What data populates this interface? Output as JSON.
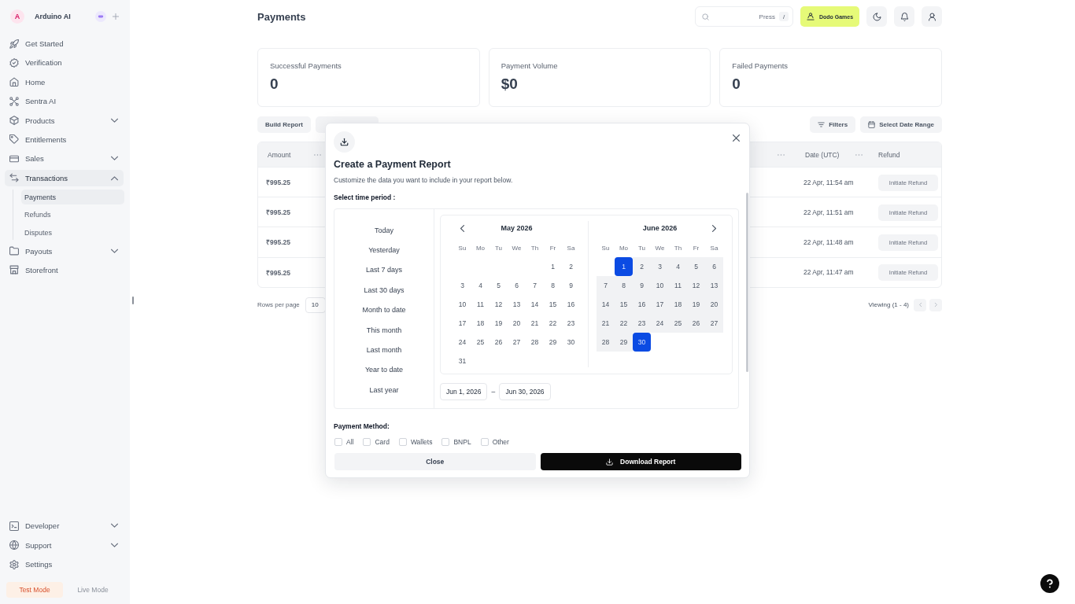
{
  "sidebar": {
    "workspace": {
      "initial": "A",
      "name": "Arduino AI"
    },
    "nav": [
      {
        "label": "Get Started",
        "kind": "link",
        "selected": false
      },
      {
        "label": "Verification",
        "kind": "link",
        "selected": false
      },
      {
        "label": "Home",
        "kind": "link",
        "selected": false
      },
      {
        "label": "Sentra AI",
        "kind": "link",
        "selected": false
      },
      {
        "label": "Products",
        "kind": "group",
        "selected": false,
        "expanded": false
      },
      {
        "label": "Entitlements",
        "kind": "link",
        "selected": false
      },
      {
        "label": "Sales",
        "kind": "group",
        "selected": false,
        "expanded": false
      },
      {
        "label": "Transactions",
        "kind": "group",
        "selected": true,
        "expanded": true,
        "children": [
          {
            "label": "Payments",
            "selected": true
          },
          {
            "label": "Refunds",
            "selected": false
          },
          {
            "label": "Disputes",
            "selected": false
          }
        ]
      },
      {
        "label": "Payouts",
        "kind": "group",
        "selected": false,
        "expanded": false
      },
      {
        "label": "Storefront",
        "kind": "link",
        "selected": false
      }
    ],
    "bottom_nav": [
      {
        "label": "Developer",
        "kind": "group",
        "expanded": false
      },
      {
        "label": "Support",
        "kind": "group",
        "expanded": false
      },
      {
        "label": "Settings",
        "kind": "link"
      }
    ],
    "modes": [
      {
        "label": "Test Mode",
        "selected": true
      },
      {
        "label": "Live Mode",
        "selected": false
      }
    ]
  },
  "header": {
    "title": "Payments",
    "search": {
      "hint": "Press",
      "shortcut": "/"
    },
    "business_button": "Dodo Games"
  },
  "stats": [
    {
      "label": "Successful Payments",
      "value": "0"
    },
    {
      "label": "Payment Volume",
      "value": "$0"
    },
    {
      "label": "Failed Payments",
      "value": "0"
    }
  ],
  "toolbar": {
    "left": [
      "Build Report"
    ],
    "right": [
      "Filters",
      "Select Date Range"
    ]
  },
  "table": {
    "columns": [
      "Amount",
      "Date (UTC)",
      "Refund"
    ],
    "rows": [
      {
        "amount": "₹995.25",
        "date": "22 Apr, 11:54 am",
        "action": "Initiate Refund"
      },
      {
        "amount": "₹995.25",
        "date": "22 Apr, 11:51 am",
        "action": "Initiate Refund"
      },
      {
        "amount": "₹995.25",
        "date": "22 Apr, 11:48 am",
        "action": "Initiate Refund"
      },
      {
        "amount": "₹995.25",
        "date": "22 Apr, 11:47 am",
        "action": "Initiate Refund"
      }
    ]
  },
  "pagination": {
    "rows_label": "Rows per page",
    "rows_value": "10",
    "viewing": "Viewing (1 - 4)"
  },
  "report_dialog": {
    "title": "Create a Payment Report",
    "subtitle": "Customize the data you want to include in your report below.",
    "period_label": "Select time period :",
    "presets": [
      "Today",
      "Yesterday",
      "Last 7 days",
      "Last 30 days",
      "Month to date",
      "This month",
      "Last month",
      "Year to date",
      "Last year"
    ],
    "calendars": [
      {
        "title": "May 2026",
        "weekdays": [
          "Su",
          "Mo",
          "Tu",
          "We",
          "Th",
          "Fr",
          "Sa"
        ],
        "weeks": [
          [
            {
              "day": "1",
              "in_range": false,
              "selected": false
            },
            {
              "day": "2",
              "in_range": false,
              "selected": false
            }
          ],
          [
            {
              "day": "3",
              "in_range": false,
              "selected": false
            },
            {
              "day": "4",
              "in_range": false,
              "selected": false
            },
            {
              "day": "5",
              "in_range": false,
              "selected": false
            },
            {
              "day": "6",
              "in_range": false,
              "selected": false
            },
            {
              "day": "7",
              "in_range": false,
              "selected": false
            },
            {
              "day": "8",
              "in_range": false,
              "selected": false
            },
            {
              "day": "9",
              "in_range": false,
              "selected": false
            }
          ],
          [
            {
              "day": "10",
              "in_range": false,
              "selected": false
            },
            {
              "day": "11",
              "in_range": false,
              "selected": false
            },
            {
              "day": "12",
              "in_range": false,
              "selected": false
            },
            {
              "day": "13",
              "in_range": false,
              "selected": false
            },
            {
              "day": "14",
              "in_range": false,
              "selected": false
            },
            {
              "day": "15",
              "in_range": false,
              "selected": false
            },
            {
              "day": "16",
              "in_range": false,
              "selected": false
            }
          ],
          [
            {
              "day": "17",
              "in_range": false,
              "selected": false
            },
            {
              "day": "18",
              "in_range": false,
              "selected": false
            },
            {
              "day": "19",
              "in_range": false,
              "selected": false
            },
            {
              "day": "20",
              "in_range": false,
              "selected": false
            },
            {
              "day": "21",
              "in_range": false,
              "selected": false
            },
            {
              "day": "22",
              "in_range": false,
              "selected": false
            },
            {
              "day": "23",
              "in_range": false,
              "selected": false
            }
          ],
          [
            {
              "day": "24",
              "in_range": false,
              "selected": false
            },
            {
              "day": "25",
              "in_range": false,
              "selected": false
            },
            {
              "day": "26",
              "in_range": false,
              "selected": false
            },
            {
              "day": "27",
              "in_range": false,
              "selected": false
            },
            {
              "day": "28",
              "in_range": false,
              "selected": false
            },
            {
              "day": "29",
              "in_range": false,
              "selected": false
            },
            {
              "day": "30",
              "in_range": false,
              "selected": false
            }
          ],
          [
            {
              "day": "31",
              "in_range": false,
              "selected": false
            }
          ]
        ]
      },
      {
        "title": "June 2026",
        "weekdays": [
          "Su",
          "Mo",
          "Tu",
          "We",
          "Th",
          "Fr",
          "Sa"
        ],
        "weeks": [
          [
            {
              "day": "1",
              "in_range": true,
              "selected": true
            },
            {
              "day": "2",
              "in_range": true,
              "selected": false
            },
            {
              "day": "3",
              "in_range": true,
              "selected": false
            },
            {
              "day": "4",
              "in_range": true,
              "selected": false
            },
            {
              "day": "5",
              "in_range": true,
              "selected": false
            },
            {
              "day": "6",
              "in_range": true,
              "selected": false
            }
          ],
          [
            {
              "day": "7",
              "in_range": true,
              "selected": false
            },
            {
              "day": "8",
              "in_range": true,
              "selected": false
            },
            {
              "day": "9",
              "in_range": true,
              "selected": false
            },
            {
              "day": "10",
              "in_range": true,
              "selected": false
            },
            {
              "day": "11",
              "in_range": true,
              "selected": false
            },
            {
              "day": "12",
              "in_range": true,
              "selected": false
            },
            {
              "day": "13",
              "in_range": true,
              "selected": false
            }
          ],
          [
            {
              "day": "14",
              "in_range": true,
              "selected": false
            },
            {
              "day": "15",
              "in_range": true,
              "selected": false
            },
            {
              "day": "16",
              "in_range": true,
              "selected": false
            },
            {
              "day": "17",
              "in_range": true,
              "selected": false
            },
            {
              "day": "18",
              "in_range": true,
              "selected": false
            },
            {
              "day": "19",
              "in_range": true,
              "selected": false
            },
            {
              "day": "20",
              "in_range": true,
              "selected": false
            }
          ],
          [
            {
              "day": "21",
              "in_range": true,
              "selected": false
            },
            {
              "day": "22",
              "in_range": true,
              "selected": false
            },
            {
              "day": "23",
              "in_range": true,
              "selected": false
            },
            {
              "day": "24",
              "in_range": true,
              "selected": false
            },
            {
              "day": "25",
              "in_range": true,
              "selected": false
            },
            {
              "day": "26",
              "in_range": true,
              "selected": false
            },
            {
              "day": "27",
              "in_range": true,
              "selected": false
            }
          ],
          [
            {
              "day": "28",
              "in_range": true,
              "selected": false
            },
            {
              "day": "29",
              "in_range": true,
              "selected": false
            },
            {
              "day": "30",
              "in_range": true,
              "selected": true
            }
          ]
        ]
      }
    ],
    "range": {
      "from": "Jun 1, 2026",
      "separator": "–",
      "to": "Jun 30, 2026"
    },
    "method_label": "Payment Method:",
    "methods": [
      {
        "label": "All",
        "checked": false
      },
      {
        "label": "Card",
        "checked": false
      },
      {
        "label": "Wallets",
        "checked": false
      },
      {
        "label": "BNPL",
        "checked": false
      },
      {
        "label": "Other",
        "checked": false
      }
    ],
    "buttons": {
      "close": "Close",
      "download": "Download Report"
    }
  }
}
